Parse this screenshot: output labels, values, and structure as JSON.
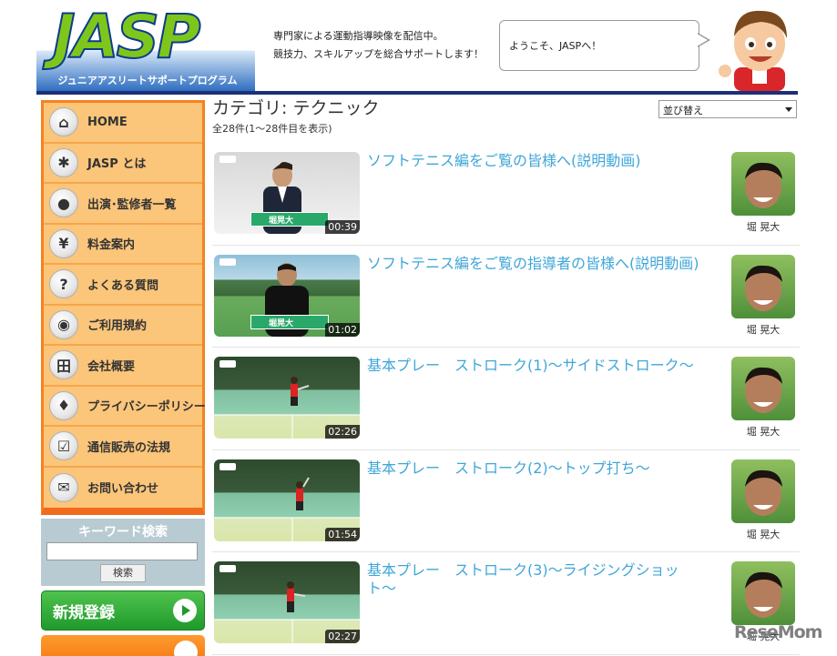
{
  "header": {
    "logo_text": "JASP",
    "logo_subtitle": "ジュニアアスリートサポートプログラム",
    "description_lines": [
      "専門家による運動指導映像を配信中。",
      "競技力、スキルアップを総合サポートします！"
    ],
    "bubble_text": "ようこそ、JASPへ！"
  },
  "sidebar": {
    "items": [
      {
        "label": "HOME",
        "icon": "house-icon",
        "glyph": "⌂"
      },
      {
        "label": "JASP とは",
        "icon": "person-icon",
        "glyph": "✱"
      },
      {
        "label": "出演･監修者一覧",
        "icon": "user-silhouette-icon",
        "glyph": "●"
      },
      {
        "label": "料金案内",
        "icon": "yen-icon",
        "glyph": "¥"
      },
      {
        "label": "よくある質問",
        "icon": "question-icon",
        "glyph": "?"
      },
      {
        "label": "ご利用規約",
        "icon": "lightbulb-icon",
        "glyph": "◉"
      },
      {
        "label": "会社概要",
        "icon": "building-icon",
        "glyph": "田"
      },
      {
        "label": "プライバシーポリシー",
        "icon": "key-icon",
        "glyph": "♦"
      },
      {
        "label": "通信販売の法規",
        "icon": "checkbox-icon",
        "glyph": "☑"
      },
      {
        "label": "お問い合わせ",
        "icon": "envelope-icon",
        "glyph": "✉"
      }
    ],
    "search": {
      "title": "キーワード検索",
      "placeholder": "",
      "button_label": "検索"
    },
    "register_label": "新規登録"
  },
  "main": {
    "category_title": "カテゴリ: テクニック",
    "count_text": "全28件(1〜28件目を表示)",
    "sort_label": "並び替え",
    "videos": [
      {
        "title": "ソフトテニス編をご覧の皆様へ(説明動画)",
        "duration": "00:39",
        "author": "堀 晃大",
        "scene": "studio",
        "caption": "堀晃大"
      },
      {
        "title": "ソフトテニス編をご覧の指導者の皆様へ(説明動画)",
        "duration": "01:02",
        "author": "堀 晃大",
        "scene": "court",
        "caption": "堀晃大"
      },
      {
        "title": "基本プレー　ストローク(1)〜サイドストローク〜",
        "duration": "02:26",
        "author": "堀 晃大",
        "scene": "indoor",
        "caption": ""
      },
      {
        "title": "基本プレー　ストローク(2)〜トップ打ち〜",
        "duration": "01:54",
        "author": "堀 晃大",
        "scene": "indoor",
        "caption": ""
      },
      {
        "title": "基本プレー　ストローク(3)〜ライジングショット〜",
        "duration": "02:27",
        "author": "堀 晃大",
        "scene": "indoor",
        "caption": ""
      }
    ]
  },
  "watermark": "ReseMom"
}
